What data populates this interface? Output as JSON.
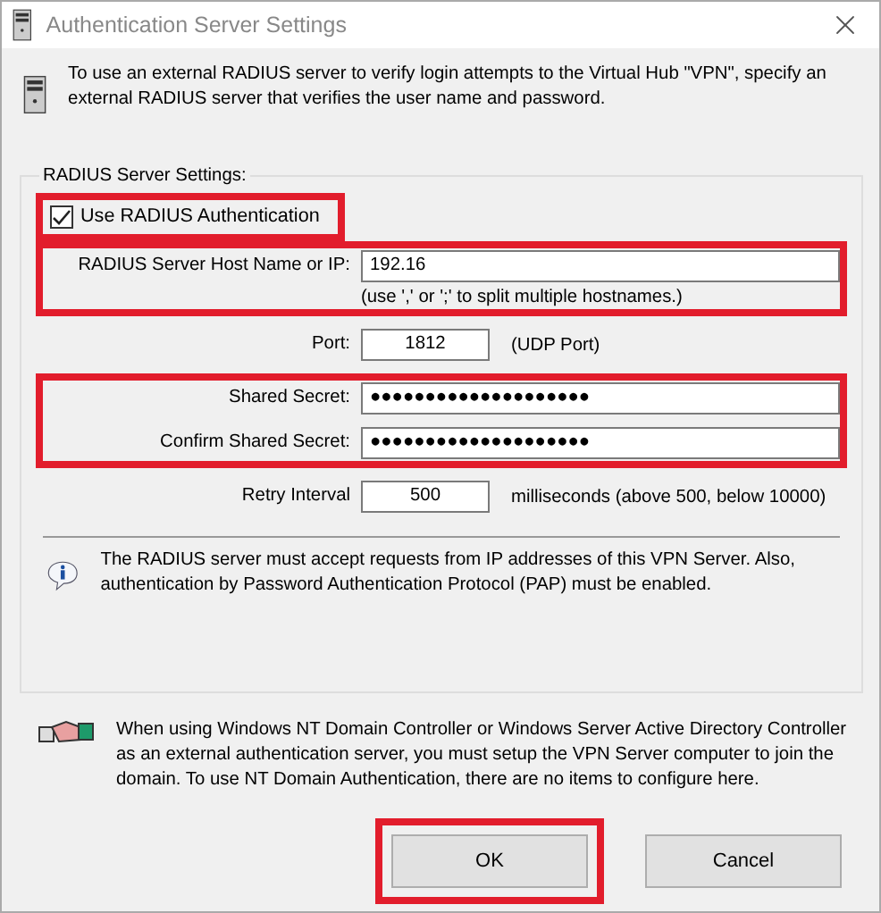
{
  "window": {
    "title": "Authentication Server Settings"
  },
  "intro": "To use an external RADIUS server to verify login attempts to the Virtual Hub \"VPN\", specify an external RADIUS server that verifies the user name and password.",
  "group": {
    "title": "RADIUS Server Settings:",
    "use_radius": {
      "label": "Use RADIUS Authentication",
      "checked": true,
      "highlighted": true
    },
    "sections": [
      {
        "highlighted": true,
        "fields": [
          {
            "kind": "wide",
            "label": "RADIUS Server Host Name or IP:",
            "value": "192.16",
            "hint": "(use ',' or ';' to split multiple hostnames.)"
          }
        ]
      },
      {
        "highlighted": false,
        "fields": [
          {
            "kind": "short",
            "label": "Port:",
            "value": "1812",
            "suffix": "(UDP Port)"
          }
        ]
      },
      {
        "highlighted": true,
        "fields": [
          {
            "kind": "wide",
            "label": "Shared Secret:",
            "value": "●●●●●●●●●●●●●●●●●●●●"
          },
          {
            "kind": "wide",
            "label": "Confirm Shared Secret:",
            "value": "●●●●●●●●●●●●●●●●●●●●"
          }
        ]
      },
      {
        "highlighted": false,
        "fields": [
          {
            "kind": "short",
            "label": "Retry Interval",
            "value": "500",
            "suffix": "milliseconds (above 500, below 10000)"
          }
        ]
      }
    ],
    "note": "The RADIUS server must accept requests from IP addresses of this VPN Server. Also, authentication by Password Authentication Protocol (PAP) must be enabled."
  },
  "nt_note": "When using Windows NT Domain Controller or Windows Server Active Directory Controller as an external authentication server, you must setup the VPN Server computer to join the domain. To use NT Domain Authentication, there are no items to configure here.",
  "buttons": [
    {
      "label": "OK",
      "highlighted": true
    },
    {
      "label": "Cancel",
      "highlighted": false
    }
  ]
}
